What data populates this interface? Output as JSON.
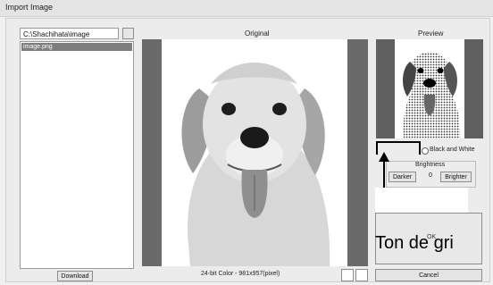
{
  "window": {
    "title": "Import Image"
  },
  "left": {
    "path_value": "C:\\Shachihata\\image",
    "files": [
      "image.png"
    ],
    "download_label": "Download"
  },
  "original": {
    "label": "Original",
    "info": "24-bit Color - 981x957(pixel)"
  },
  "preview": {
    "label": "Preview",
    "black_white_label": "Black and White",
    "brightness": {
      "title": "Brightness",
      "darker_label": "Darker",
      "value": "0",
      "brighter_label": "Brighter"
    },
    "ok_label": "OK",
    "cancel_label": "Cancel"
  },
  "overlay": {
    "caption": "Ton de gri"
  }
}
